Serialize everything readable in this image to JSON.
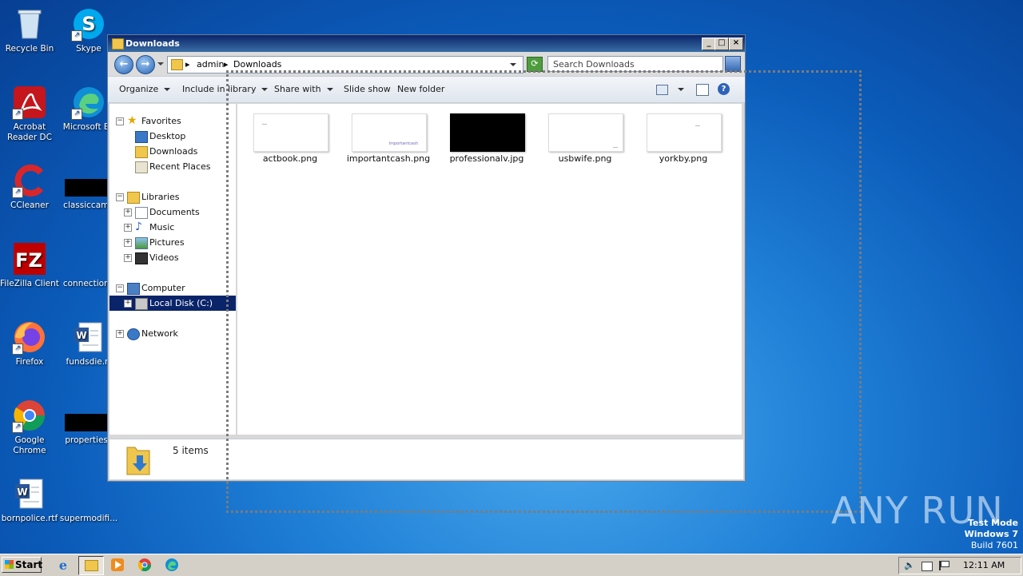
{
  "desktop": {
    "icons": [
      {
        "label": "Recycle Bin"
      },
      {
        "label": "Skype"
      },
      {
        "label": "Acrobat Reader DC"
      },
      {
        "label": "Microsoft Ed"
      },
      {
        "label": "CCleaner"
      },
      {
        "label": "classiccame"
      },
      {
        "label": "FileZilla Client"
      },
      {
        "label": "connectiona"
      },
      {
        "label": "Firefox"
      },
      {
        "label": "fundsdie.rt"
      },
      {
        "label": "Google Chrome"
      },
      {
        "label": "propertiesc"
      },
      {
        "label": "bornpolice.rtf"
      },
      {
        "label": "supermodifi..."
      }
    ]
  },
  "window": {
    "title": "Downloads",
    "address": {
      "crumb1": "admin",
      "crumb2": "Downloads"
    },
    "search_placeholder": "Search Downloads",
    "toolbar": {
      "organize": "Organize",
      "include_in_library": "Include in library",
      "share_with": "Share with",
      "slide_show": "Slide show",
      "new_folder": "New folder"
    },
    "nav": {
      "favorites": "Favorites",
      "desktop": "Desktop",
      "downloads": "Downloads",
      "recent_places": "Recent Places",
      "libraries": "Libraries",
      "documents": "Documents",
      "music": "Music",
      "pictures": "Pictures",
      "videos": "Videos",
      "computer": "Computer",
      "local_disk": "Local Disk (C:)",
      "network": "Network"
    },
    "files": [
      {
        "name": "actbook.png",
        "thumb_text": ""
      },
      {
        "name": "importantcash.png",
        "thumb_text": "importantcash"
      },
      {
        "name": "professionalv.jpg",
        "thumb_text": ""
      },
      {
        "name": "usbwife.png",
        "thumb_text": ""
      },
      {
        "name": "yorkby.png",
        "thumb_text": ""
      }
    ],
    "status": "5 items"
  },
  "taskbar": {
    "start": "Start",
    "clock": "12:11 AM"
  },
  "watermark": {
    "line1": "Test Mode",
    "line2": "Windows 7",
    "line3": "Build 7601",
    "brand": "ANY RUN"
  },
  "colors": {
    "selection": "#0a246a",
    "titlebar": "#0a246a"
  }
}
